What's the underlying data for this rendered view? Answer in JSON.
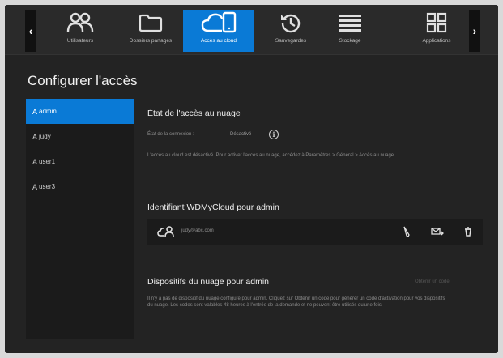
{
  "nav": {
    "prev_arrow": "‹",
    "next_arrow": "›",
    "items": [
      {
        "label": "Utilisateurs",
        "icon": "users-icon"
      },
      {
        "label": "Dossiers partagés",
        "icon": "folder-icon"
      },
      {
        "label": "Accès au cloud",
        "icon": "cloud-devices-icon",
        "active": true
      },
      {
        "label": "Sauvegardes",
        "icon": "history-icon"
      },
      {
        "label": "Stockage",
        "icon": "storage-icon"
      },
      {
        "label": "Applications",
        "icon": "apps-icon"
      }
    ]
  },
  "page_title": "Configurer l'accès",
  "sidebar": {
    "items": [
      {
        "label": "admin",
        "active": true
      },
      {
        "label": "judy"
      },
      {
        "label": "user1"
      },
      {
        "label": "user3"
      }
    ]
  },
  "cloud_status": {
    "heading": "État de l'accès au nuage",
    "connection_label": "État de la connexion :",
    "connection_value": "Désactivé",
    "description": "L'accès au cloud est désactivé. Pour activer l'accès au nuage, accédez à Paramètres > Général > Accès au nuage."
  },
  "wdmycloud": {
    "heading": "Identifiant WDMyCloud pour admin",
    "email": "judy@abc.com"
  },
  "devices": {
    "heading": "Dispositifs du nuage pour admin",
    "action": "Obtenir un code",
    "description": "Il n'y a pas de dispositif du nuage configuré pour admin. Cliquez sur Obtenir un code pour générer un code d'activation pour vos dispositifs du nuage. Les codes sont valables 48 heures à l'entrée de la demande et ne peuvent être utilisés qu'une fois."
  },
  "colors": {
    "accent": "#0a7ad6",
    "background": "#232323",
    "panel": "#1b1b1b"
  }
}
